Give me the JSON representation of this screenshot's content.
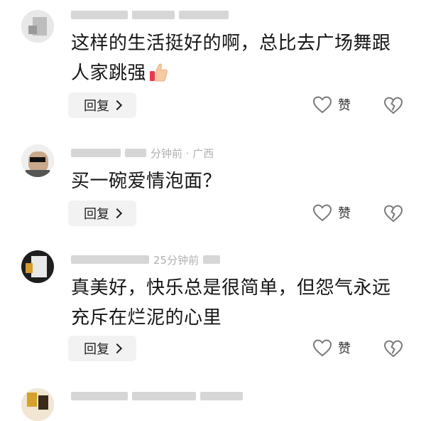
{
  "comments": [
    {
      "user": "",
      "meta": "",
      "text": "这样的生活挺好的啊，总比去广场舞跟人家跳强",
      "text_emoji": "thumbs-up-icon",
      "reply_label": "回复",
      "like_label": "赞"
    },
    {
      "user": "",
      "meta": "分钟前 · 广西",
      "text": "买一碗爱情泡面？",
      "reply_label": "回复",
      "like_label": "赞"
    },
    {
      "user": "",
      "meta": "25分钟前",
      "text": "真美好，快乐总是很简单，但怨气永远充斥在烂泥的心里",
      "reply_label": "回复",
      "like_label": "赞"
    }
  ],
  "colors": {
    "icon": "#7a7a7a",
    "reply_bg": "#f2f2f2",
    "meta": "#b0b0b0"
  }
}
